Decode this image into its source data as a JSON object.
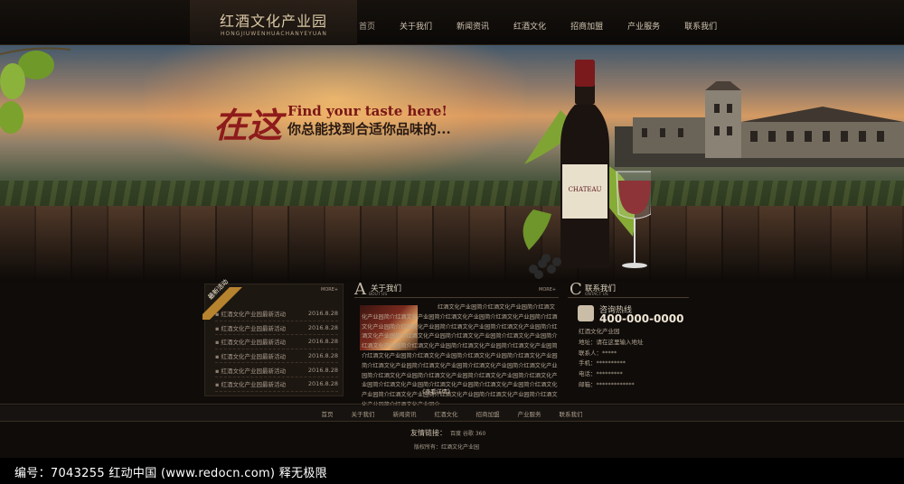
{
  "header": {
    "logo_cn": "红酒文化产业园",
    "logo_en": "HONGJIUWENHUACHANYEYUAN",
    "nav": [
      "首页",
      "关于我们",
      "新闻资讯",
      "红酒文化",
      "招商加盟",
      "产业服务",
      "联系我们"
    ]
  },
  "banner": {
    "slogan_big": "在这",
    "slogan_en": "Find your taste here!",
    "slogan_cn": "你总能找到合适你品味的...",
    "bottle_label": "CHATEAU"
  },
  "news": {
    "ribbon": "最新活动",
    "more": "MORE+",
    "items": [
      {
        "title": "红酒文化产业园最新活动",
        "date": "2016.8.28"
      },
      {
        "title": "红酒文化产业园最新活动",
        "date": "2016.8.28"
      },
      {
        "title": "红酒文化产业园最新活动",
        "date": "2016.8.28"
      },
      {
        "title": "红酒文化产业园最新活动",
        "date": "2016.8.28"
      },
      {
        "title": "红酒文化产业园最新活动",
        "date": "2016.8.28"
      },
      {
        "title": "红酒文化产业园最新活动",
        "date": "2016.8.28"
      }
    ]
  },
  "about": {
    "letter": "A",
    "title_cn": "关于我们",
    "title_en": "BOUT US",
    "more": "MORE+",
    "text": "红酒文化产业园简介红酒文化产业园简介红酒文化产业园简介红酒文化产业园简介红酒文化产业园简介红酒文化产业园简介红酒文化产业园简介红酒文化产业园简介红酒文化产业园简介红酒文化产业园简介红酒文化产业园简介红酒文化产业园简介红酒文化产业园简介红酒文化产业园简介红酒文化产业园简介红酒文化产业园简介红酒文化产业园简介红酒文化产业园简介红酒文化产业园简介红酒文化产业园简介红酒文化产业园简介红酒文化产业园简介红酒文化产业园简介红酒文化产业园简介红酒文化产业园简介红酒文化产业园简介红酒文化产业园简介红酒文化产业园简介红酒文化产业园简介红酒文化产业园简介红酒文化产业园简介红酒文化产业园简介红酒文化产业园简介红酒文化产业园简介红酒文化产业园简介红酒文化产业园简介红酒文化产业园简介红酒文化产业园简介红酒文化产业园介...",
    "detail_link": "《查看详情》"
  },
  "contact": {
    "letter": "C",
    "title_cn": "联系我们",
    "title_en": "ONTACT US",
    "hotline_label": "咨询热线",
    "hotline": "400-000-0000",
    "lines": [
      "红酒文化产业园",
      "地址：请在这里输入地址",
      "联系人：*****",
      "手机：**********",
      "电话：*********",
      "邮箱：*************"
    ]
  },
  "footer": {
    "nav": [
      "首页",
      "关于我们",
      "新闻资讯",
      "红酒文化",
      "招商加盟",
      "产业服务",
      "联系我们"
    ],
    "friend_label": "友情链接：",
    "friend_links": "百度  谷歌  360",
    "copyright": "版权所有：红酒文化产业园"
  },
  "watermark": "编号：7043255    红动中国 (www.redocn.com)    释无极限"
}
